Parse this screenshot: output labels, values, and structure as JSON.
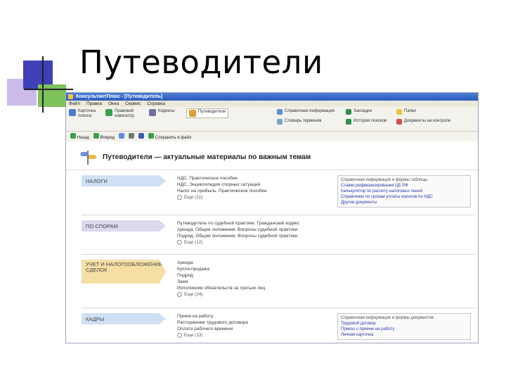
{
  "slide": {
    "title": "Путеводители"
  },
  "window": {
    "title": "КонсультантПлюс - [Путеводитель]",
    "menu": [
      "Файл",
      "Правка",
      "Окна",
      "Сервис",
      "Справка"
    ],
    "toolbar1": [
      {
        "label": "Карточка поиска",
        "icon": "search-card-icon",
        "color": "#4b7bd1"
      },
      {
        "label": "Правовой навигатор",
        "icon": "navigator-icon",
        "color": "#3aa04a"
      },
      {
        "label": "Кодексы",
        "icon": "codes-icon",
        "color": "#6f6f9f"
      },
      {
        "label": "Путеводители",
        "icon": "guides-icon",
        "color": "#e0a030"
      },
      {
        "label": "Справочная информация",
        "icon": "reference-icon",
        "color": "#5b8fd8"
      },
      {
        "label": "Словарь терминов",
        "icon": "dictionary-icon",
        "color": "#7aa0c8"
      },
      {
        "label": "Закладки",
        "icon": "bookmarks-icon",
        "color": "#2f8f4a"
      },
      {
        "label": "История поисков",
        "icon": "history-icon",
        "color": "#2f8f4a"
      },
      {
        "label": "Папки",
        "icon": "folders-icon",
        "color": "#f0c040"
      },
      {
        "label": "Документы на контроле",
        "icon": "control-icon",
        "color": "#d05050"
      }
    ],
    "toolbar2": [
      "Назад",
      "Вперед",
      "Найти",
      "Печать",
      "В Word",
      "Сохранить в файл"
    ]
  },
  "page": {
    "title": "Путеводители — актуальные материалы по важным темам",
    "sections": [
      {
        "category": "НАЛОГИ",
        "color": "#cfe0f5",
        "links": [
          "НДС. Практическое пособие",
          "НДС. Энциклопедия спорных ситуаций",
          "Налог на прибыль. Практическое пособие"
        ],
        "more": "Еще (11)",
        "box_title": "Справочная информация и формы таблицы",
        "box_items": [
          "Ставки рефинансирования ЦБ РФ",
          "Калькулятор по расчету налоговых пеней",
          "Справочник по срокам уплаты налогов по НДС",
          "Другие документы"
        ]
      },
      {
        "category": "ПО СПОРАМ",
        "color": "#dcd8ee",
        "links": [
          "Путеводитель по судебной практике: Гражданский кодекс",
          "Аренда. Общие положения. Вопросы судебной практики",
          "Подряд. Общие положения. Вопросы судебной практики"
        ],
        "more": "Еще (12)",
        "box_title": "",
        "box_items": []
      },
      {
        "category": "УЧЕТ И НАЛОГООБЛОЖЕНИЕ СДЕЛОК",
        "color": "#f6dfa4",
        "links": [
          "Аренда",
          "Купля-продажа",
          "Подряд",
          "Заем",
          "Исполнение обязательств за третьих лиц"
        ],
        "more": "Еще (24)",
        "box_title": "",
        "box_items": []
      },
      {
        "category": "КАДРЫ",
        "color": "#cfe0f5",
        "links": [
          "Прием на работу",
          "Расторжение трудового договора",
          "Оплата рабочего времени"
        ],
        "more": "Еще (13)",
        "box_title": "Справочная информация и формы документов",
        "box_items": [
          "Трудовой договор",
          "Приказ о приеме на работу",
          "Личная карточка"
        ]
      }
    ]
  }
}
